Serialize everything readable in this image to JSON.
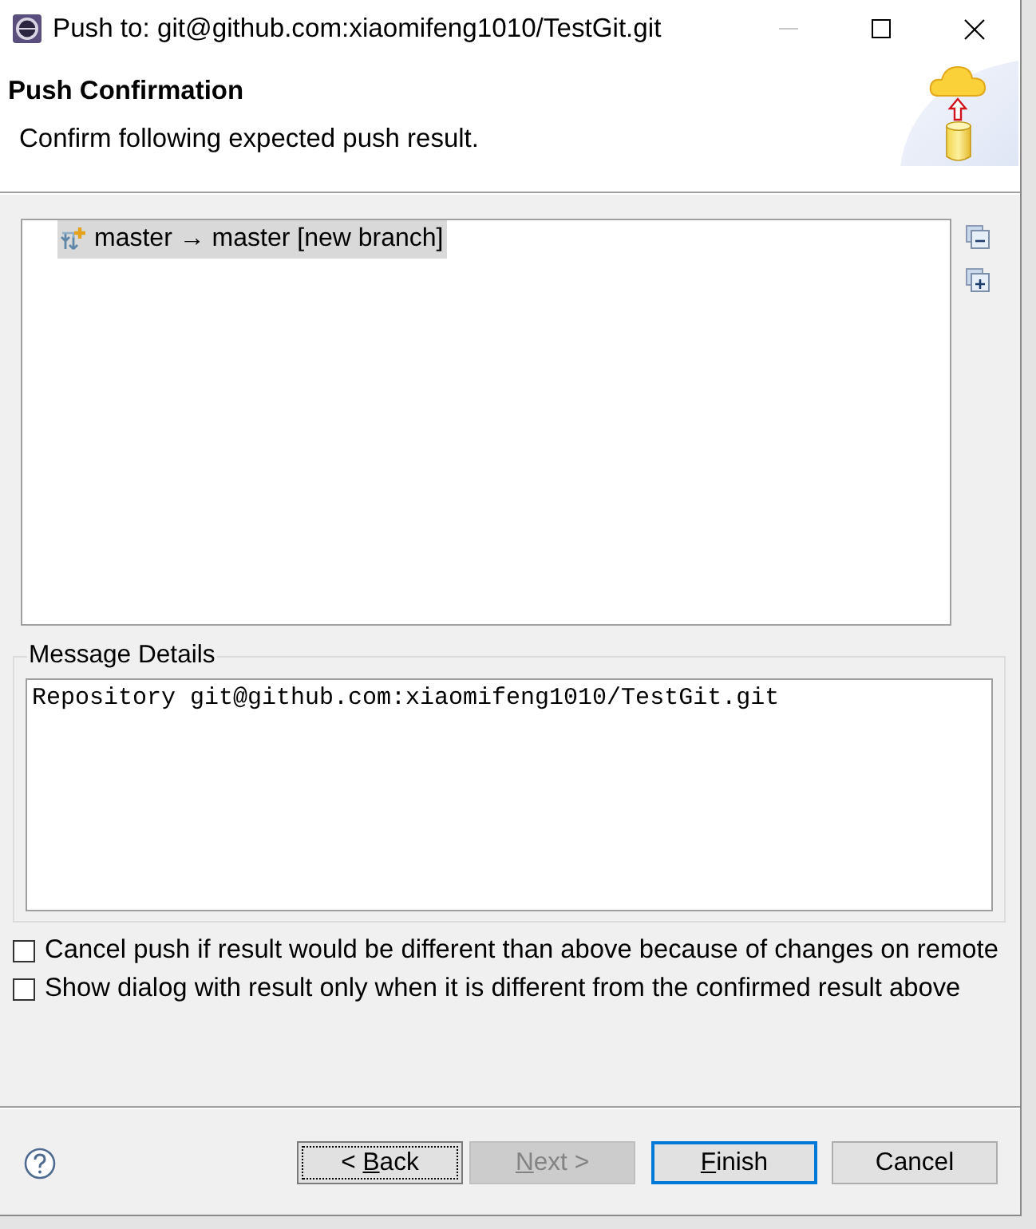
{
  "window": {
    "title": "Push to: git@github.com:xiaomifeng1010/TestGit.git",
    "controls": [
      {
        "kind": "minimize",
        "disabled": true
      },
      {
        "kind": "maximize",
        "disabled": false
      },
      {
        "kind": "close",
        "disabled": false
      }
    ]
  },
  "header": {
    "title": "Push Confirmation",
    "description": "Confirm following expected push result."
  },
  "tree": {
    "items": [
      {
        "label": "master → master [new branch]",
        "selected": true
      }
    ],
    "toolbar": [
      {
        "kind": "collapse"
      },
      {
        "kind": "expand"
      }
    ]
  },
  "message_details": {
    "label": "Message Details",
    "value": "Repository git@github.com:xiaomifeng1010/TestGit.git"
  },
  "options": [
    {
      "label": "Cancel push if result would be different than above because of changes on remote",
      "checked": false
    },
    {
      "label": "Show dialog with result only when it is different from the confirmed result above",
      "checked": false
    }
  ],
  "buttons": [
    {
      "label_parts": [
        {
          "text": "< ",
          "underlined": false
        },
        {
          "text": "B",
          "underlined": true
        },
        {
          "text": "ack",
          "underlined": false
        }
      ],
      "disabled": false,
      "default": false,
      "focused": true
    },
    {
      "label_parts": [
        {
          "text": "N",
          "underlined": true
        },
        {
          "text": "ext >",
          "underlined": false
        }
      ],
      "disabled": true,
      "default": false,
      "focused": false
    },
    {
      "label_parts": [
        {
          "text": "F",
          "underlined": true
        },
        {
          "text": "inish",
          "underlined": false
        }
      ],
      "disabled": false,
      "default": true,
      "focused": false
    },
    {
      "label_parts": [
        {
          "text": "Cancel",
          "underlined": false
        }
      ],
      "disabled": false,
      "default": false,
      "focused": false
    }
  ]
}
